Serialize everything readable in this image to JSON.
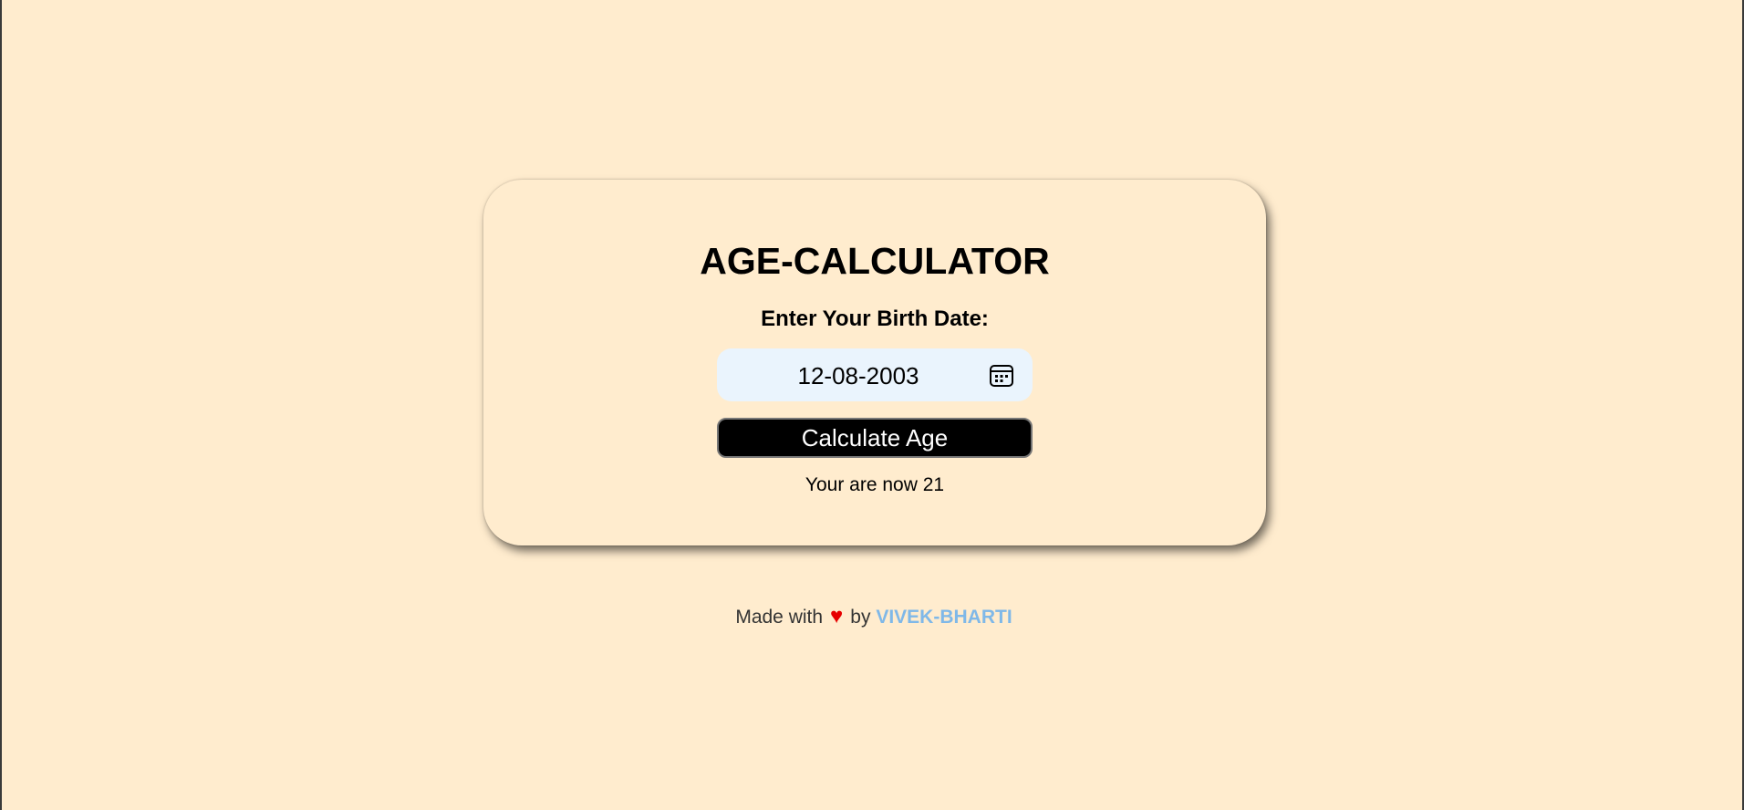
{
  "app": {
    "title": "AGE-CALCULATOR",
    "prompt_label": "Enter Your Birth Date:"
  },
  "date_input": {
    "value": "12-08-2003",
    "icon": "calendar-icon"
  },
  "calculate_button": {
    "label": "Calculate Age"
  },
  "result": {
    "text": "Your are now 21"
  },
  "footer": {
    "made_with": "Made with",
    "heart": "♥",
    "by": "by",
    "author": "VIVEK-BHARTI"
  },
  "colors": {
    "background": "#ffecce",
    "input_background": "#eaf4fd",
    "button_background": "#000000",
    "heart": "#e60000",
    "author_link": "#7fb8e8"
  }
}
